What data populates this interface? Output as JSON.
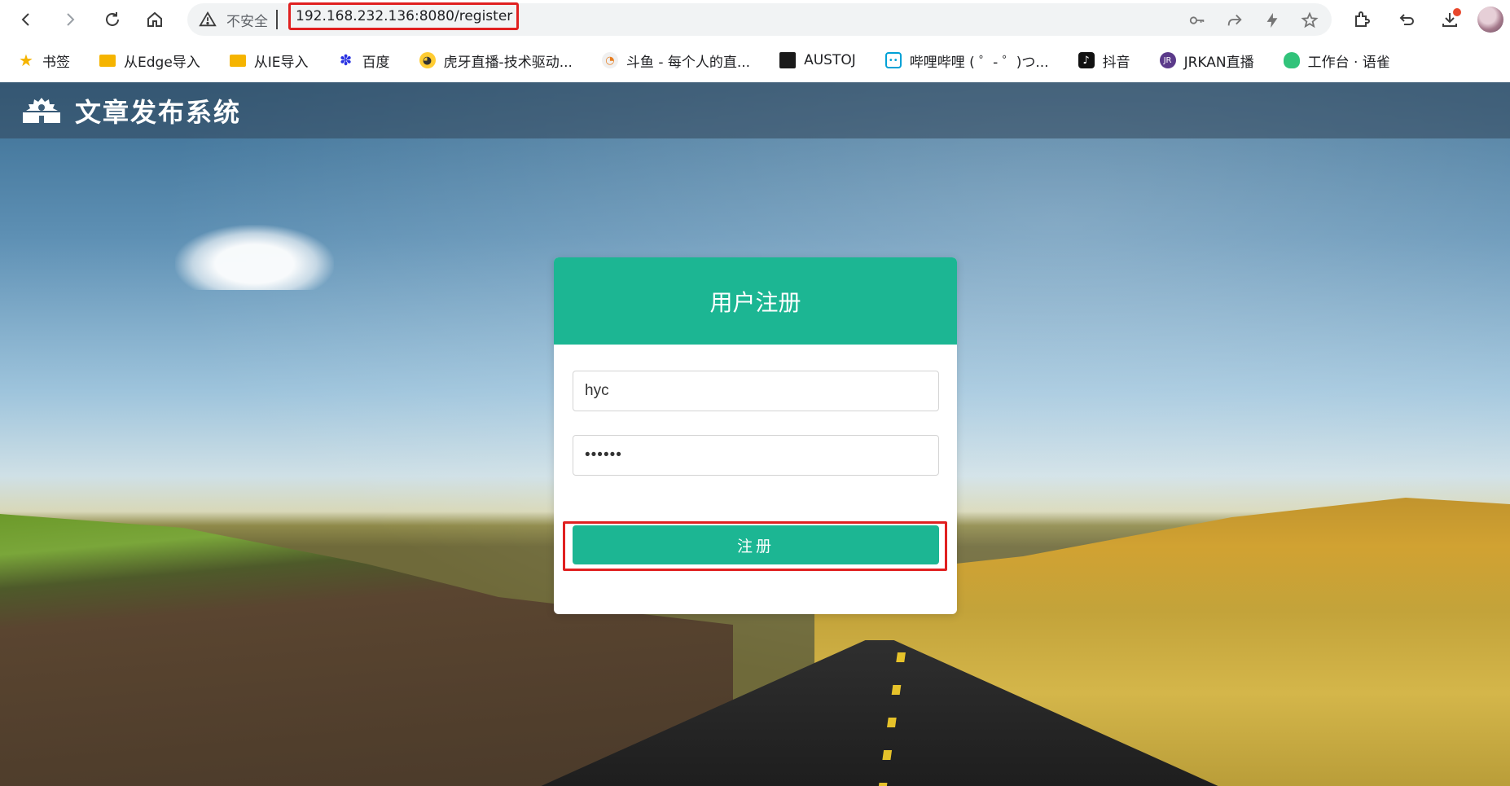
{
  "browser": {
    "security_label": "不安全",
    "url": "192.168.232.136:8080/register",
    "bookmarks": [
      {
        "label": "书签",
        "icon": "star-icon"
      },
      {
        "label": "从Edge导入",
        "icon": "folder-icon"
      },
      {
        "label": "从IE导入",
        "icon": "folder-icon"
      },
      {
        "label": "百度",
        "icon": "baidu-icon"
      },
      {
        "label": "虎牙直播-技术驱动...",
        "icon": "huya-icon"
      },
      {
        "label": "斗鱼 - 每个人的直...",
        "icon": "douyu-icon"
      },
      {
        "label": "AUSTOJ",
        "icon": "austoj-icon"
      },
      {
        "label": "哔哩哔哩 ( ゜- ゜)つ...",
        "icon": "bilibili-icon"
      },
      {
        "label": "抖音",
        "icon": "douyin-icon"
      },
      {
        "label": "JRKAN直播",
        "icon": "jrkan-icon"
      },
      {
        "label": "工作台 · 语雀",
        "icon": "yuque-icon"
      }
    ]
  },
  "site": {
    "title": "文章发布系统"
  },
  "form": {
    "heading": "用户注册",
    "username_value": "hyc",
    "password_value": "••••••",
    "submit_label": "注册"
  },
  "colors": {
    "accent": "#1cb693",
    "highlight": "#e02020"
  }
}
